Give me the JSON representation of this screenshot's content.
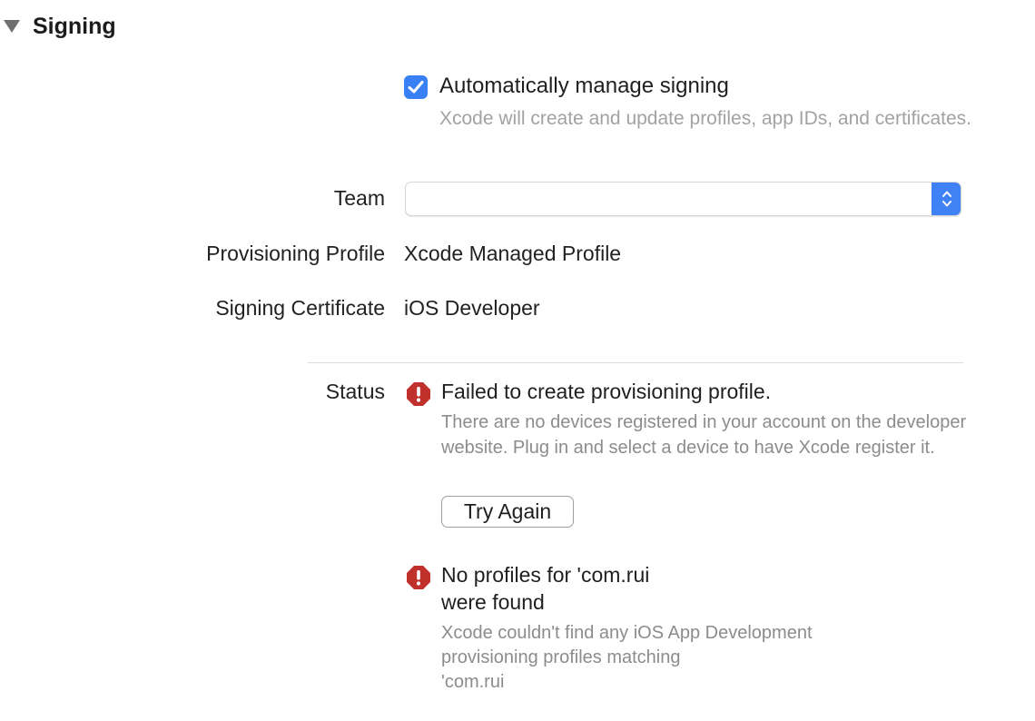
{
  "section": {
    "title": "Signing"
  },
  "auto_signing": {
    "checkbox_label": "Automatically manage signing",
    "description": "Xcode will create and update profiles, app IDs, and certificates.",
    "checked": true
  },
  "fields": {
    "team_label": "Team",
    "team_value": "",
    "profile_label": "Provisioning Profile",
    "profile_value": "Xcode Managed Profile",
    "certificate_label": "Signing Certificate",
    "certificate_value": "iOS Developer"
  },
  "status": {
    "label": "Status",
    "errors": [
      {
        "title": "Failed to create provisioning profile.",
        "description": "There are no devices registered in your account on the developer website. Plug in and select a device to have Xcode register it.",
        "button_label": "Try Again"
      },
      {
        "title_line1": "No profiles for 'com.rui",
        "title_line2": "were found",
        "description_line1": "Xcode couldn't find any iOS App Development",
        "description_line2": "provisioning profiles matching",
        "description_line3": "'com.rui"
      }
    ]
  },
  "colors": {
    "accent": "#3a80f5",
    "error": "#c0312b",
    "secondary_text": "#8c8c8c"
  },
  "icons": {
    "disclosure": "disclosure-triangle-icon",
    "checkbox": "checkmark-icon",
    "popup": "up-down-chevron-icon",
    "error": "error-octagon-icon"
  }
}
